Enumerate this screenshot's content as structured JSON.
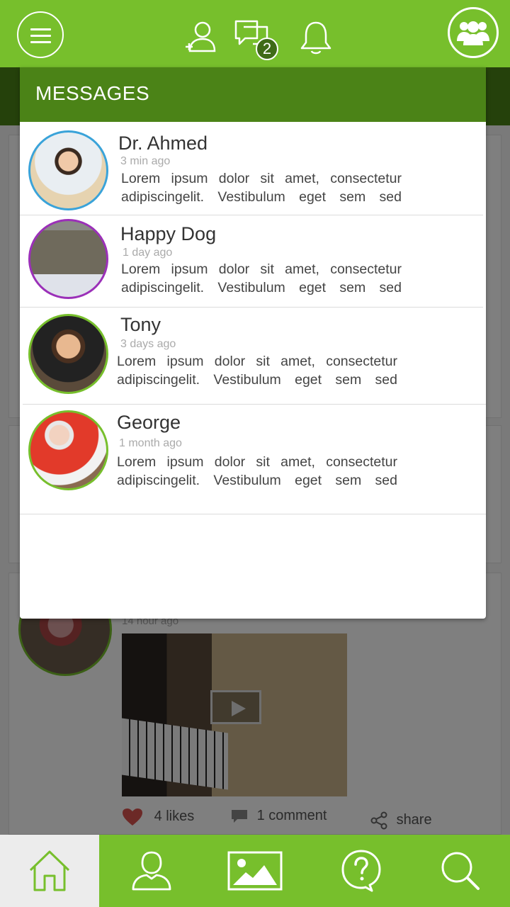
{
  "topbar": {
    "icons": [
      "menu-icon",
      "add-friend-icon",
      "messages-icon",
      "bell-icon",
      "group-icon"
    ],
    "messages_badge": "2"
  },
  "messages_panel": {
    "title": "MESSAGES",
    "items": [
      {
        "name": "Dr. Ahmed",
        "time": "3 min ago",
        "line1": "Lorem ipsum dolor sit amet, consectetur",
        "line2": "adipiscingelit. Vestibulum eget sem sed",
        "ring_color": "#3aa3d9"
      },
      {
        "name": "Happy Dog",
        "time": "1 day ago",
        "line1": "Lorem ipsum dolor sit amet, consectetur",
        "line2": "adipiscingelit. Vestibulum eget sem sed",
        "ring_color": "#9b30b8"
      },
      {
        "name": "Tony",
        "time": "3 days ago",
        "line1": "Lorem ipsum dolor sit amet, consectetur",
        "line2": "adipiscingelit. Vestibulum eget sem sed",
        "ring_color": "#77bf2c"
      },
      {
        "name": "George",
        "time": "1 month ago",
        "line1": "Lorem ipsum dolor sit amet, consectetur",
        "line2": "adipiscingelit. Vestibulum eget sem sed",
        "ring_color": "#77bf2c"
      }
    ]
  },
  "feed_post": {
    "time": "14 hour ago",
    "likes": "4 likes",
    "comments": "1 comment",
    "share": "share"
  },
  "bottom_nav": {
    "items": [
      "home-icon",
      "profile-icon",
      "gallery-icon",
      "help-icon",
      "search-icon"
    ],
    "active": "home"
  },
  "colors": {
    "brand_green": "#77bf2c",
    "dark_green": "#4b8317",
    "like_heart": "#d9534f"
  }
}
